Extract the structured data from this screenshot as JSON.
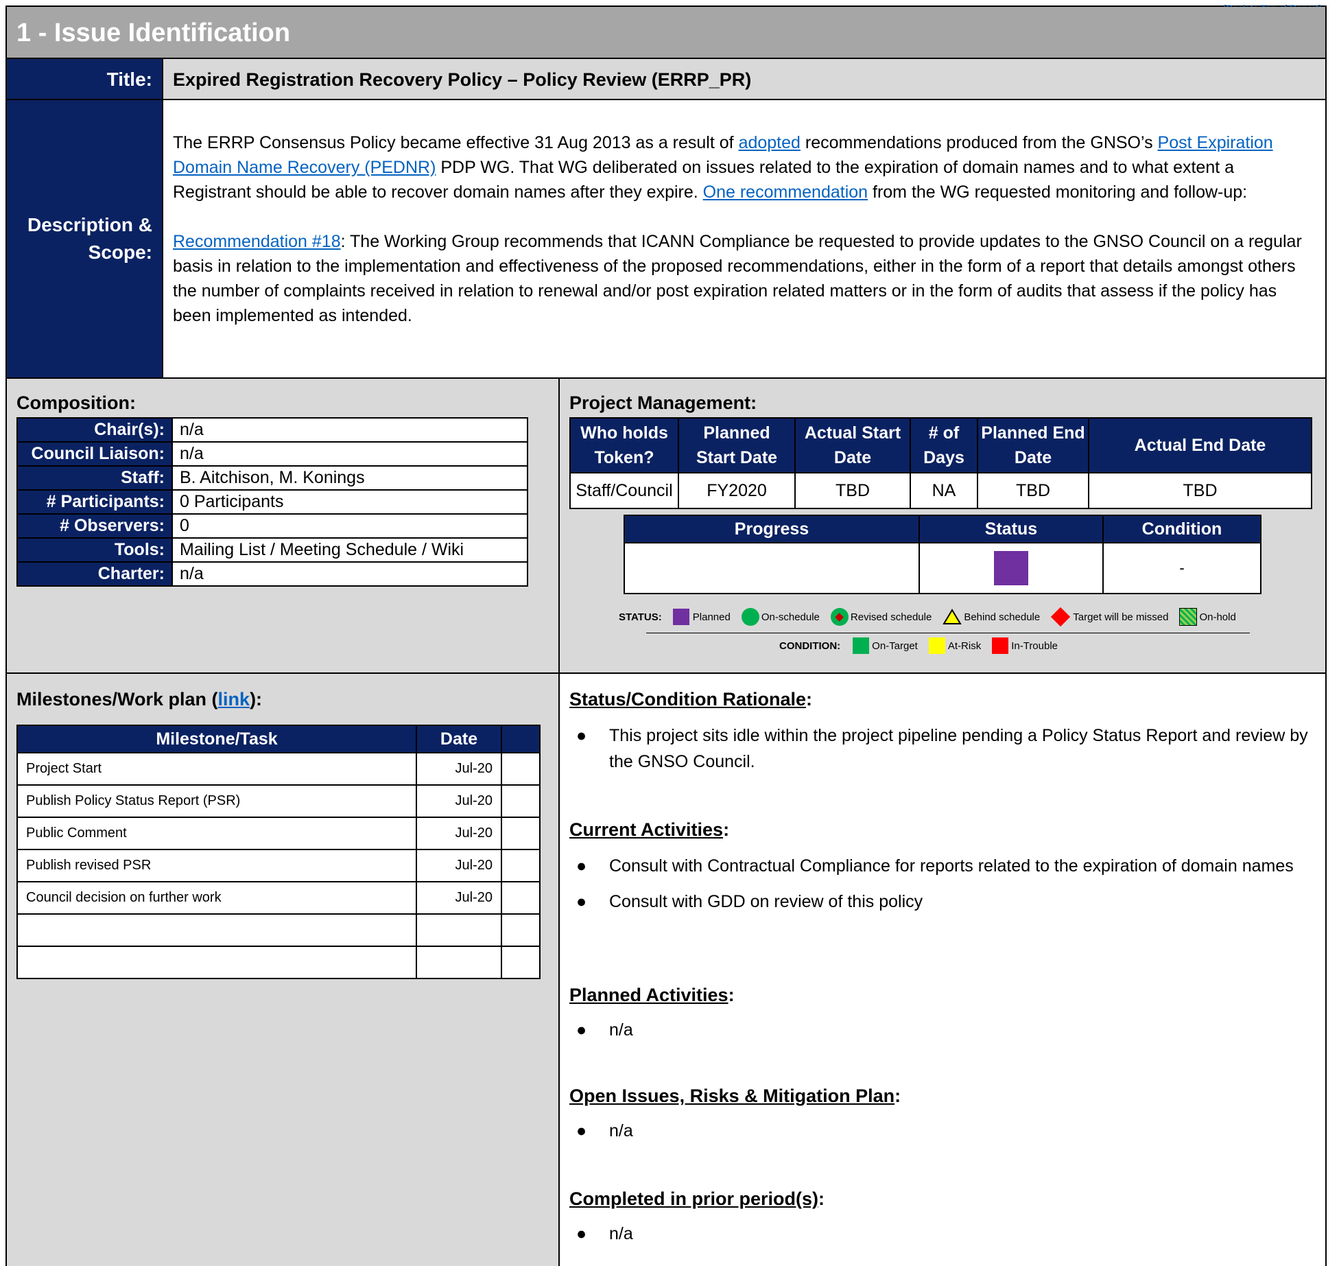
{
  "top_link": "[Back to Top of Report]",
  "section_header": "1 - Issue Identification",
  "title_row": {
    "label": "Title:",
    "value": "Expired Registration Recovery Policy – Policy Review (ERRP_PR)"
  },
  "description": {
    "label_line1": "Description &",
    "label_line2": "Scope:",
    "p1_a": "The ERRP Consensus Policy became effective 31 Aug 2013 as a result of ",
    "p1_link1": "adopted",
    "p1_b": " recommendations produced from the GNSO’s ",
    "p1_link2": "Post Expiration Domain Name Recovery (PEDNR)",
    "p1_c": " PDP WG. That WG deliberated on issues related to the expiration of domain names and to what extent a Registrant should be able to recover domain names after they expire. ",
    "p1_link3": "One recommendation",
    "p1_d": " from the WG requested monitoring and follow-up:",
    "p2_link": "Recommendation #18",
    "p2_text": ": The Working Group recommends that ICANN Compliance be requested to provide updates to the GNSO Council on a regular basis in relation to the implementation and effectiveness of the proposed recommendations, either in the form of a report that details amongst others the number of complaints received in relation to renewal and/or post expiration related matters or in the form of audits that assess if the policy has been implemented as intended."
  },
  "composition": {
    "title": "Composition:",
    "rows": [
      {
        "label": "Chair(s):",
        "value": "n/a"
      },
      {
        "label": "Council Liaison:",
        "value": "n/a"
      },
      {
        "label": "Staff:",
        "value": "B. Aitchison, M. Konings"
      },
      {
        "label": "# Participants:",
        "value": "0 Participants"
      },
      {
        "label": "# Observers:",
        "value": "0"
      },
      {
        "label": "Tools:",
        "value": "Mailing List / Meeting Schedule / Wiki"
      },
      {
        "label": "Charter:",
        "value": "n/a"
      }
    ]
  },
  "project_management": {
    "title": "Project Management:",
    "headers": [
      "Who holds Token?",
      "Planned Start Date",
      "Actual Start Date",
      "# of Days",
      "Planned End Date",
      "Actual End Date"
    ],
    "values": [
      "Staff/Council",
      "FY2020",
      "TBD",
      "NA",
      "TBD",
      "TBD"
    ],
    "status_headers": [
      "Progress",
      "Status",
      "Condition"
    ],
    "progress": "",
    "status": "Planned",
    "condition": "-"
  },
  "legend": {
    "status_label": "STATUS:",
    "status_items": [
      "Planned",
      "On-schedule",
      "Revised schedule",
      "Behind schedule",
      "Target will be missed",
      "On-hold"
    ],
    "condition_label": "CONDITION:",
    "condition_items": [
      "On-Target",
      "At-Risk",
      "In-Trouble"
    ],
    "colors": {
      "planned": "#7030a0",
      "on_schedule": "#00b050",
      "revised": "#c00000",
      "behind": "#ffff00",
      "missed": "#ff0000",
      "on_hold": "#92d050",
      "on_target": "#00b050",
      "at_risk": "#ffff00",
      "in_trouble": "#ff0000"
    }
  },
  "milestones": {
    "title_a": "Milestones/Work plan (",
    "title_link": "link",
    "title_b": "):",
    "headers": [
      "Milestone/Task",
      "Date",
      ""
    ],
    "rows": [
      {
        "task": "Project Start",
        "date": "Jul-20",
        "extra": ""
      },
      {
        "task": "Publish Policy Status Report (PSR)",
        "date": "Jul-20",
        "extra": ""
      },
      {
        "task": "Public Comment",
        "date": "Jul-20",
        "extra": ""
      },
      {
        "task": "Publish revised PSR",
        "date": "Jul-20",
        "extra": ""
      },
      {
        "task": "Council decision on further work",
        "date": "Jul-20",
        "extra": ""
      },
      {
        "task": "",
        "date": "",
        "extra": ""
      },
      {
        "task": "",
        "date": "",
        "extra": ""
      }
    ]
  },
  "rationale": {
    "title": "Status/Condition Rationale",
    "colon": ":",
    "bullets": [
      "This project sits idle within the project pipeline pending a Policy Status Report and review by the GNSO Council."
    ]
  },
  "current": {
    "title": "Current Activities",
    "colon": ":",
    "bullets": [
      "Consult with Contractual Compliance for reports related to the expiration of domain names",
      "Consult with GDD on review of this policy"
    ]
  },
  "planned": {
    "title": "Planned Activities",
    "colon": ":",
    "bullets": [
      "n/a"
    ]
  },
  "issues": {
    "title": "Open Issues, Risks & Mitigation Plan",
    "colon": ":",
    "bullets": [
      "n/a"
    ]
  },
  "completed": {
    "title": "Completed in prior period(s)",
    "colon": ":",
    "bullets": [
      "n/a"
    ]
  },
  "bullet_char": "●"
}
